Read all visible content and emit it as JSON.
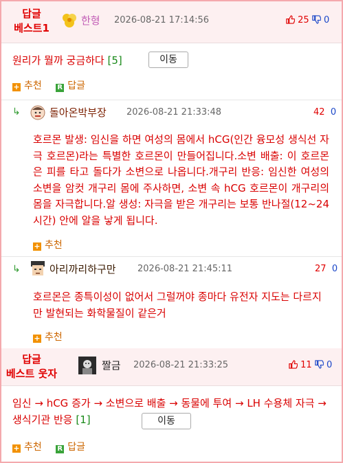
{
  "best1": {
    "badge_line1": "답글",
    "badge_line2": "베스트1",
    "nick": "한형",
    "date": "2026-08-21 17:14:56",
    "up": "25",
    "down": "0",
    "body": "원리가 뭘까 궁금하다",
    "count": "[5]",
    "move_label": "이동",
    "recommend_label": "추천",
    "reply_label": "답글"
  },
  "reply1": {
    "nick": "돌아온박부장",
    "date": "2026-08-21 21:33:48",
    "up": "42",
    "down": "0",
    "body": "호르몬 발생: 임신을 하면 여성의 몸에서 hCG(인간 융모성 생식선 자극 호르몬)라는 특별한 호르몬이 만들어집니다.소변 배출: 이 호르몬은 피를 타고 돌다가 소변으로 나옵니다.개구리 반응: 임신한 여성의 소변을 암컷 개구리 몸에 주사하면, 소변 속 hCG 호르몬이 개구리의 몸을 자극합니다.알 생성: 자극을 받은 개구리는 보통 반나절(12~24시간) 안에 알을 낳게 됩니다.",
    "recommend_label": "추천"
  },
  "reply2": {
    "nick": "아리까리하구만",
    "date": "2026-08-21 21:45:11",
    "up": "27",
    "down": "0",
    "body": "호르몬은 종특이성이 없어서 그럴꺼야 종마다 유전자 지도는 다르지만 발현되는 화학물질이 같은거",
    "recommend_label": "추천"
  },
  "best2": {
    "badge_line1": "답글",
    "badge_line2": "베스트 웃자",
    "nick": "짤금",
    "date": "2026-08-21 21:33:25",
    "up": "11",
    "down": "0",
    "body": "임신 → hCG 증가 → 소변으로 배출 → 동물에 투여 → LH 수용체 자극 → 생식기관 반응",
    "count": "[1]",
    "move_label": "이동",
    "recommend_label": "추천",
    "reply_label": "답글"
  },
  "colors": {
    "border": "#f4a9ad",
    "header_bg": "#fdf0f1",
    "red": "#d90000",
    "blue": "#1a46c8",
    "green": "#1a8a1a"
  },
  "icons": {
    "thumb_up": "thumb-up-icon",
    "thumb_down": "thumb-down-icon",
    "reply": "reply-arrow-icon",
    "plus": "plus-icon",
    "r": "r-reply-icon"
  }
}
